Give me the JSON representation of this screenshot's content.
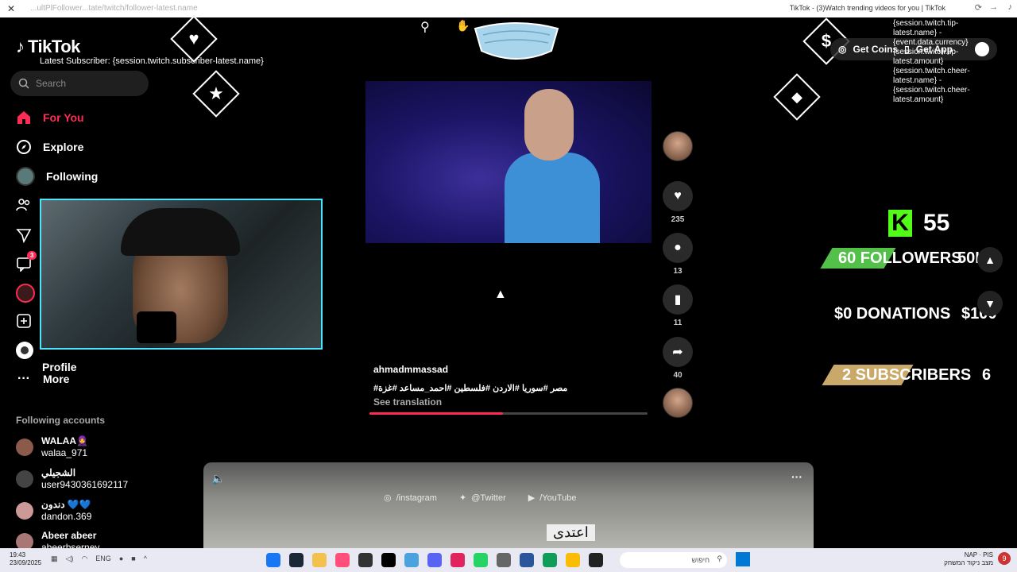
{
  "titlebar": {
    "url": "...ultPlFollower...tate/twitch/follower-latest.name",
    "title": "TikTok - (3)Watch trending videos for you | TikTok"
  },
  "sidebar": {
    "logo": "TikTok",
    "latest_subscriber": "Latest Subscriber: {session.twitch.subscriber-latest.name}",
    "search_placeholder": "Search",
    "nav": {
      "for_you": "For You",
      "explore": "Explore",
      "following": "Following",
      "more": "More",
      "profile_peek": "Profile"
    },
    "messages_badge": "3",
    "following_accounts_title": "Following accounts",
    "accounts": [
      {
        "display": "WALAA🧕",
        "handle": "walaa_971"
      },
      {
        "display": "الشجيلي",
        "handle": "user9430361692117"
      },
      {
        "display": "دندون 💙💙",
        "handle": "dandon.369"
      },
      {
        "display": "Abeer abeer",
        "handle": "abeerbserney"
      }
    ]
  },
  "video": {
    "author": "ahmadmmassad",
    "tags": "#مصر #سوريا #الاردن #فلسطين #احمد_مساعد #غزة",
    "see_translation": "See translation",
    "progress_fraction": 0.48,
    "likes": "235",
    "comments": "13",
    "saves": "11",
    "shares": "40"
  },
  "overlay": {
    "tip_text": "{session.twitch.tip-latest.name} - {event.data.currency}{session.twitch.tip-latest.amount}",
    "cheer_text": "{session.twitch.cheer-latest.name} - {session.twitch.cheer-latest.amount}",
    "get_coins": "Get Coins",
    "get_app": "Get App",
    "kick_count": "55",
    "followers": "60 FOLLOWERS",
    "followers_goal": "50K",
    "donations": "$0 DONATIONS",
    "donations_goal": "$100",
    "subscribers": "2 SUBSCRIBERS",
    "subscribers_goal": "6",
    "instagram": "/instagram",
    "twitter": "@Twitter",
    "youtube": "/YouTube"
  },
  "next_video": {
    "sign_text": "اعتدى"
  },
  "taskbar": {
    "time": "19:43",
    "date": "23/09/2025",
    "lang": "ENG",
    "search": "חיפוש",
    "right_line1": "NAP · PIS",
    "right_line2": "מצב ניקוד המשחק",
    "notif_count": "9"
  },
  "colors": {
    "accent": "#fe2c55",
    "kick_green": "#53fc18",
    "webcam_border": "#49e6ff"
  }
}
